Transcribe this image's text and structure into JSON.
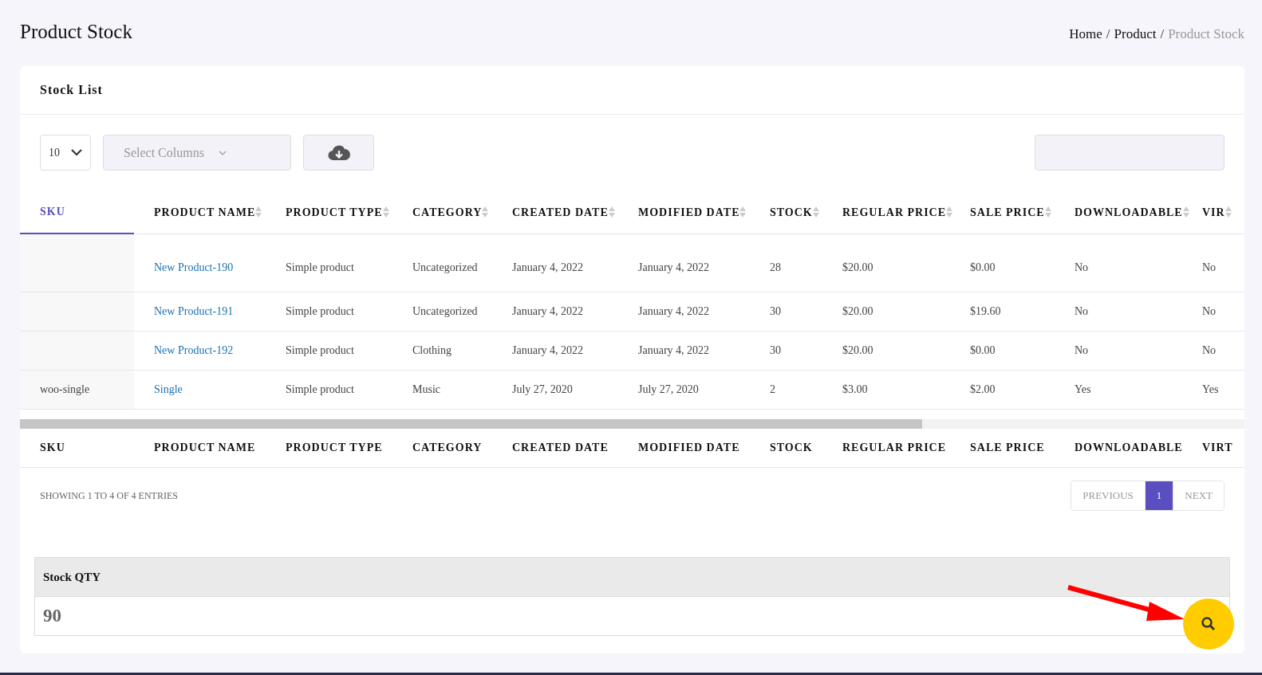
{
  "page_title": "Product Stock",
  "breadcrumb_separator": "/",
  "breadcrumb": [
    {
      "label": "Home",
      "current": false
    },
    {
      "label": "Product",
      "current": false
    },
    {
      "label": "Product Stock",
      "current": true
    }
  ],
  "card_title": "Stock List",
  "page_size": "10",
  "column_select": {
    "placeholder": "Select Columns"
  },
  "columns": [
    {
      "label": "SKU",
      "selected": true
    },
    {
      "label": "PRODUCT NAME",
      "selected": false
    },
    {
      "label": "PRODUCT TYPE",
      "selected": false
    },
    {
      "label": "CATEGORY",
      "selected": false
    },
    {
      "label": "CREATED DATE",
      "selected": false
    },
    {
      "label": "MODIFIED DATE",
      "selected": false
    },
    {
      "label": "STOCK",
      "selected": false
    },
    {
      "label": "REGULAR PRICE",
      "selected": false
    },
    {
      "label": "SALE PRICE",
      "selected": false
    },
    {
      "label": "DOWNLOADABLE",
      "selected": false
    },
    {
      "label": "VIR",
      "selected": false
    }
  ],
  "rows": [
    [
      "",
      "New Product-190",
      "Simple product",
      "Uncategorized",
      "January 4, 2022",
      "January 4, 2022",
      "28",
      "$20.00",
      "$0.00",
      "No",
      "No"
    ],
    [
      "",
      "New Product-191",
      "Simple product",
      "Uncategorized",
      "January 4, 2022",
      "January 4, 2022",
      "30",
      "$20.00",
      "$19.60",
      "No",
      "No"
    ],
    [
      "",
      "New Product-192",
      "Simple product",
      "Clothing",
      "January 4, 2022",
      "January 4, 2022",
      "30",
      "$20.00",
      "$0.00",
      "No",
      "No"
    ],
    [
      "woo-single",
      "Single",
      "Simple product",
      "Music",
      "July 27, 2020",
      "July 27, 2020",
      "2",
      "$3.00",
      "$2.00",
      "Yes",
      "Yes"
    ]
  ],
  "footer_columns": [
    "SKU",
    "PRODUCT NAME",
    "PRODUCT TYPE",
    "CATEGORY",
    "CREATED DATE",
    "MODIFIED DATE",
    "STOCK",
    "REGULAR PRICE",
    "SALE PRICE",
    "DOWNLOADABLE",
    "VIRT"
  ],
  "entries_info": "SHOWING 1 TO 4 OF 4 ENTRIES",
  "pagination": [
    {
      "label": "PREVIOUS",
      "kind": "nav",
      "selected": false
    },
    {
      "label": "1",
      "kind": "num",
      "selected": true
    },
    {
      "label": "NEXT",
      "kind": "nav",
      "selected": false
    }
  ],
  "stock_qty": {
    "label": "Stock QTY",
    "value": "90"
  }
}
